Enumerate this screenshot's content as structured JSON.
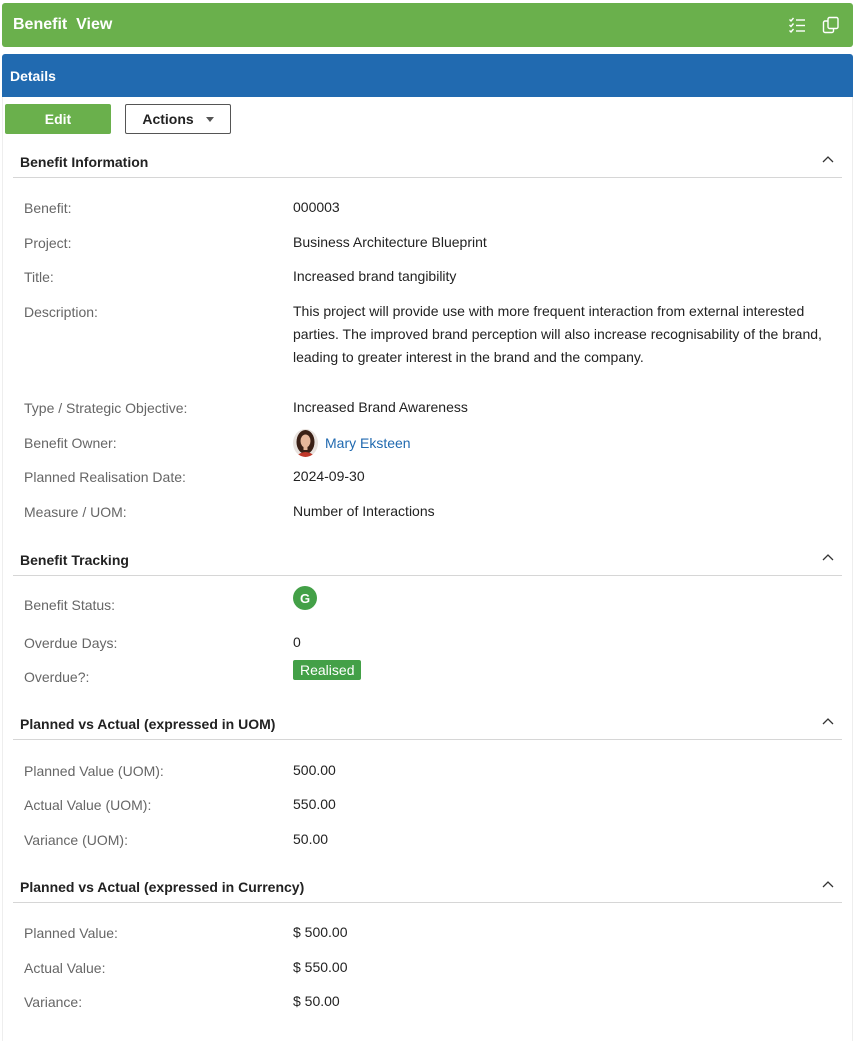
{
  "header": {
    "title": "Benefit  View",
    "icons": [
      "checklist-icon",
      "copy-icon"
    ]
  },
  "details_bar": {
    "label": "Details"
  },
  "toolbar": {
    "edit_label": "Edit",
    "actions_label": "Actions"
  },
  "sections": {
    "benefit_information": {
      "title": "Benefit Information",
      "rows": {
        "benefit": {
          "label": "Benefit:",
          "value": "000003"
        },
        "project": {
          "label": "Project:",
          "value": "Business Architecture Blueprint"
        },
        "title": {
          "label": "Title:",
          "value": "Increased brand tangibility"
        },
        "description": {
          "label": "Description:",
          "value": "This project will provide use with more frequent interaction from external interested parties. The improved brand perception will also increase recognisability of the brand, leading to greater interest in the brand and the company."
        },
        "type": {
          "label": "Type / Strategic Objective:",
          "value": "Increased Brand Awareness"
        },
        "owner": {
          "label": "Benefit Owner:",
          "value": "Mary Eksteen"
        },
        "planned_date": {
          "label": "Planned Realisation Date:",
          "value": "2024-09-30"
        },
        "measure": {
          "label": "Measure / UOM:",
          "value": "Number of Interactions"
        }
      }
    },
    "benefit_tracking": {
      "title": "Benefit Tracking",
      "rows": {
        "status": {
          "label": "Benefit Status:",
          "value": "G"
        },
        "overdue_days": {
          "label": "Overdue Days:",
          "value": "0"
        },
        "overdue": {
          "label": "Overdue?:",
          "value": "Realised"
        }
      }
    },
    "uom": {
      "title": "Planned vs Actual (expressed in UOM)",
      "rows": {
        "planned": {
          "label": "Planned Value (UOM):",
          "value": "500.00"
        },
        "actual": {
          "label": "Actual Value (UOM):",
          "value": "550.00"
        },
        "variance": {
          "label": "Variance (UOM):",
          "value": "50.00"
        }
      }
    },
    "currency": {
      "title": "Planned vs Actual (expressed in Currency)",
      "rows": {
        "planned": {
          "label": "Planned Value:",
          "value": "$ 500.00"
        },
        "actual": {
          "label": "Actual Value:",
          "value": "$ 550.00"
        },
        "variance": {
          "label": "Variance:",
          "value": "$ 50.00"
        }
      }
    }
  },
  "colors": {
    "header_green": "#6ab04c",
    "details_blue": "#216ab0",
    "status_green": "#43a047",
    "link_blue": "#216ab0"
  }
}
